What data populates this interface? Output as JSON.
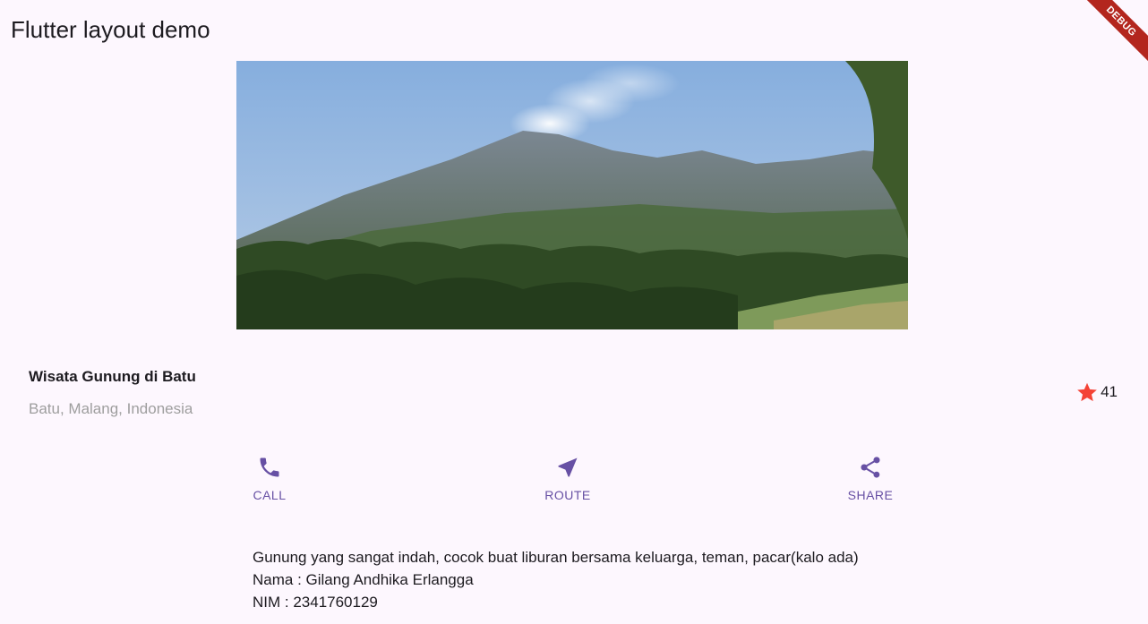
{
  "app": {
    "title": "Flutter layout demo",
    "debug_label": "DEBUG"
  },
  "image": {
    "subject": "mountain-landscape"
  },
  "place": {
    "name": "Wisata Gunung di Batu",
    "location": "Batu, Malang, Indonesia",
    "rating_count": "41",
    "star_icon": "star-icon",
    "star_color": "#f44336"
  },
  "actions": [
    {
      "label": "CALL",
      "icon": "phone-icon"
    },
    {
      "label": "ROUTE",
      "icon": "navigation-icon"
    },
    {
      "label": "SHARE",
      "icon": "share-icon"
    }
  ],
  "description": {
    "line1": "Gunung yang sangat indah, cocok buat liburan bersama keluarga, teman, pacar(kalo ada)",
    "line2": "Nama : Gilang Andhika Erlangga",
    "line3": "NIM : 2341760129"
  },
  "colors": {
    "accent": "#6750a4",
    "background": "#fdf7fe"
  }
}
